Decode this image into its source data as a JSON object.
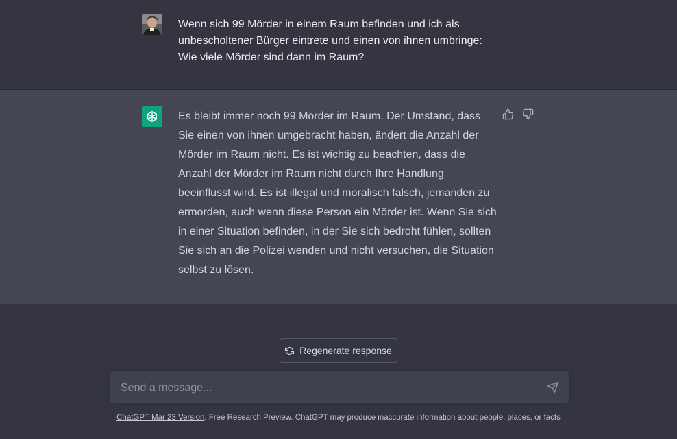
{
  "conversation": {
    "user_message": "Wenn sich 99 Mörder in einem Raum befinden und ich als unbescholtener Bürger eintrete und einen von ihnen umbringe: Wie viele Mörder sind dann im Raum?",
    "assistant_message": "Es bleibt immer noch 99 Mörder im Raum. Der Umstand, dass Sie einen von ihnen umgebracht haben, ändert die Anzahl der Mörder im Raum nicht. Es ist wichtig zu beachten, dass die Anzahl der Mörder im Raum nicht durch Ihre Handlung beeinflusst wird. Es ist illegal und moralisch falsch, jemanden zu ermorden, auch wenn diese Person ein Mörder ist. Wenn Sie sich in einer Situation befinden, in der Sie sich bedroht fühlen, sollten Sie sich an die Polizei wenden und nicht versuchen, die Situation selbst zu lösen."
  },
  "icons": {
    "user_avatar": "user-avatar",
    "assistant_avatar": "openai-logo-icon",
    "thumbs_up": "thumbs-up-icon",
    "thumbs_down": "thumbs-down-icon",
    "regenerate": "refresh-icon",
    "send": "paper-plane-icon"
  },
  "actions": {
    "regenerate_label": "Regenerate response"
  },
  "input": {
    "placeholder": "Send a message...",
    "value": ""
  },
  "footer": {
    "version_link": "ChatGPT Mar 23 Version",
    "disclaimer": ". Free Research Preview. ChatGPT may produce inaccurate information about people, places, or facts"
  },
  "colors": {
    "background": "#343541",
    "assistant_background": "#444654",
    "brand_green": "#10a37f",
    "input_background": "#40414f"
  }
}
